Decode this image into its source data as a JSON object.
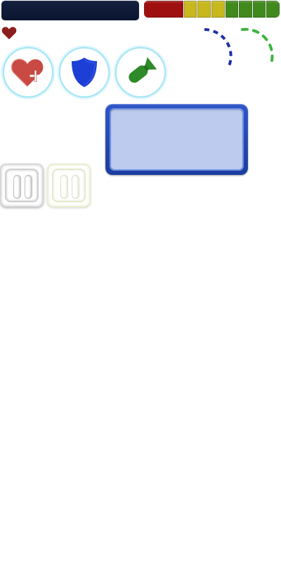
{
  "colors": {
    "title_bar": "#0f1a38",
    "heart": "#8b1f1f",
    "arc_left": "#1f2fa8",
    "arc_right": "#3db43d",
    "panel_border": "#2448b8",
    "panel_fill": "#bccbee",
    "power_ring": "#a7e6f6"
  },
  "health_bar": {
    "segments": [
      {
        "level": "low",
        "color": "#9e0f0f",
        "weight": 3
      },
      {
        "level": "mid",
        "color": "#c8b81e",
        "weight": 1
      },
      {
        "level": "mid",
        "color": "#c8b81e",
        "weight": 1
      },
      {
        "level": "mid",
        "color": "#c8b81e",
        "weight": 1
      },
      {
        "level": "high",
        "color": "#3f8a1a",
        "weight": 1
      },
      {
        "level": "high",
        "color": "#3f8a1a",
        "weight": 1
      },
      {
        "level": "high",
        "color": "#3f8a1a",
        "weight": 1
      },
      {
        "level": "high",
        "color": "#3f8a1a",
        "weight": 1
      }
    ]
  },
  "lives": {
    "count": 1,
    "icon": "heart-icon"
  },
  "powerups": [
    {
      "id": "heal",
      "icon": "heart-plus-icon"
    },
    {
      "id": "shield",
      "icon": "shield-icon"
    },
    {
      "id": "bomb",
      "icon": "bomb-icon"
    }
  ],
  "pause_buttons": [
    {
      "id": "pause-normal",
      "icon": "pause-icon"
    },
    {
      "id": "pause-faded",
      "icon": "pause-icon"
    }
  ]
}
